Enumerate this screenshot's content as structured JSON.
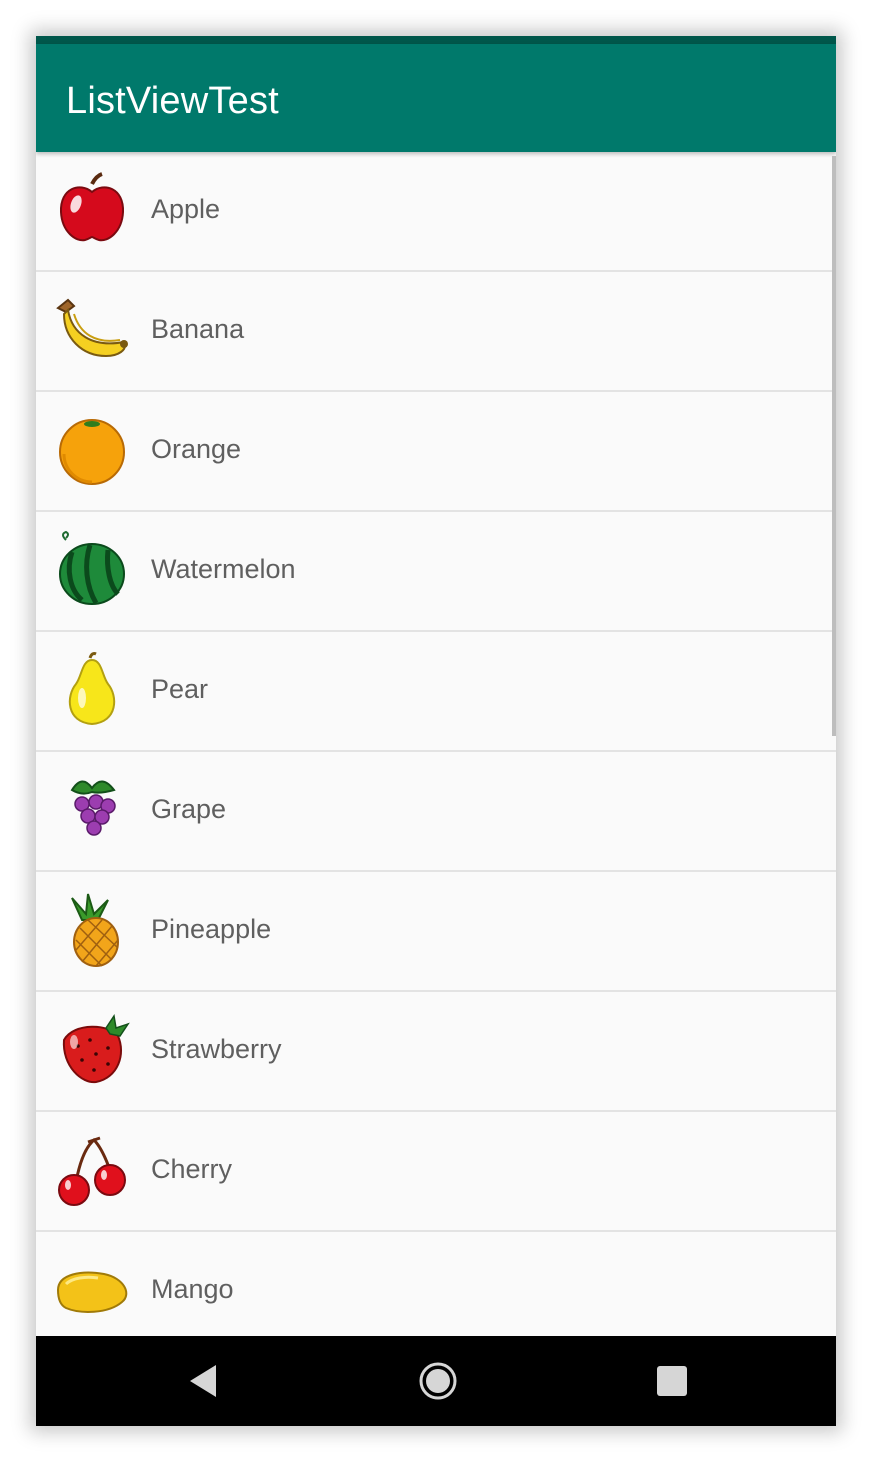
{
  "app_bar": {
    "title": "ListViewTest",
    "color": "#00796b"
  },
  "fruits": [
    {
      "label": "Apple",
      "icon": "apple-icon"
    },
    {
      "label": "Banana",
      "icon": "banana-icon"
    },
    {
      "label": "Orange",
      "icon": "orange-icon"
    },
    {
      "label": "Watermelon",
      "icon": "watermelon-icon"
    },
    {
      "label": "Pear",
      "icon": "pear-icon"
    },
    {
      "label": "Grape",
      "icon": "grape-icon"
    },
    {
      "label": "Pineapple",
      "icon": "pineapple-icon"
    },
    {
      "label": "Strawberry",
      "icon": "strawberry-icon"
    },
    {
      "label": "Cherry",
      "icon": "cherry-icon"
    },
    {
      "label": "Mango",
      "icon": "mango-icon"
    }
  ],
  "nav_bar": {
    "back_icon": "back-triangle-icon",
    "home_icon": "home-circle-icon",
    "recents_icon": "recents-square-icon"
  }
}
